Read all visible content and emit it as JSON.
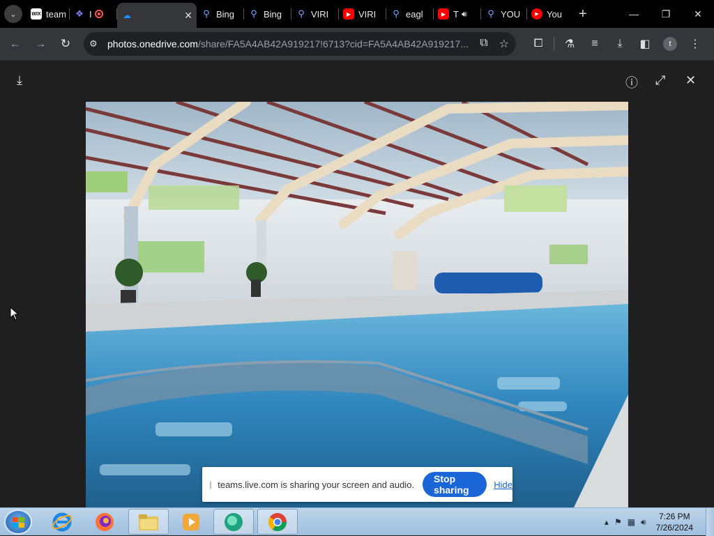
{
  "browser": {
    "tabs": [
      {
        "title": "team",
        "favicon": "wix-icon"
      },
      {
        "title": "I",
        "favicon": "teams-icon",
        "recording": true
      },
      {
        "title": "",
        "favicon": "onedrive-icon",
        "active": true,
        "close": "✕"
      },
      {
        "title": "Bing",
        "favicon": "bing-search-icon"
      },
      {
        "title": "Bing",
        "favicon": "bing-search-icon"
      },
      {
        "title": "VIRI",
        "favicon": "bing-search-icon"
      },
      {
        "title": "VIRI",
        "favicon": "youtube-icon"
      },
      {
        "title": "eagl",
        "favicon": "bing-search-icon"
      },
      {
        "title": "T",
        "favicon": "youtube-icon",
        "audio": true
      },
      {
        "title": "YOU",
        "favicon": "bing-search-icon"
      },
      {
        "title": "You",
        "favicon": "youtube-circle-icon"
      }
    ],
    "new_tab": "+",
    "window_controls": {
      "minimize": "—",
      "restore": "❐",
      "close": "✕"
    },
    "address": {
      "domain": "photos.onedrive.com",
      "path": "/share/FA5A4AB42A919217!6713?cid=FA5A4AB42A919217..."
    },
    "profile_initial": "t"
  },
  "viewer": {
    "download": "⤓",
    "info": "ⓘ",
    "expand": "⤢",
    "close": "✕"
  },
  "share_notice": {
    "grip": "||",
    "text": "teams.live.com is sharing your screen and audio.",
    "stop_label": "Stop sharing",
    "hide_label": "Hide"
  },
  "taskbar": {
    "apps": [
      "internet-explorer-icon",
      "firefox-icon",
      "file-explorer-icon",
      "media-player-icon",
      "edge-icon",
      "chrome-icon"
    ],
    "clock": {
      "time": "7:26 PM",
      "date": "7/26/2024"
    }
  }
}
